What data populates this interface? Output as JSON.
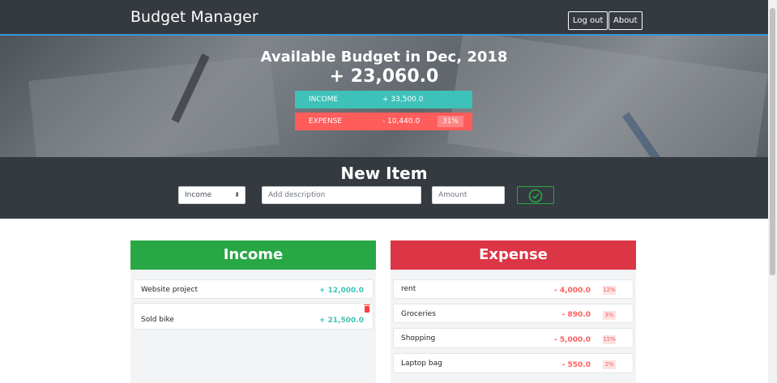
{
  "app": {
    "title": "Budget Manager"
  },
  "nav": {
    "logout": "Log out",
    "about": "About"
  },
  "budget": {
    "title": "Available Budget in Dec, 2018",
    "value": "+ 23,060.0",
    "income_label": "INCOME",
    "income_value": "+ 33,500.0",
    "expense_label": "EXPENSE",
    "expense_value": "- 10,440.0",
    "expense_percent": "31%"
  },
  "new_item": {
    "title": "New Item",
    "type_selected": "Income",
    "description_placeholder": "Add description",
    "amount_placeholder": "Amount"
  },
  "income": {
    "title": "Income",
    "items": [
      {
        "description": "Website project",
        "amount": "+ 12,000.0"
      },
      {
        "description": "Sold bike",
        "amount": "+ 21,500.0"
      }
    ]
  },
  "expense": {
    "title": "Expense",
    "items": [
      {
        "description": "rent",
        "amount": "- 4,000.0",
        "percent": "12%"
      },
      {
        "description": "Groceries",
        "amount": "- 890.0",
        "percent": "3%"
      },
      {
        "description": "Shopping",
        "amount": "- 5,000.0",
        "percent": "15%"
      },
      {
        "description": "Laptop bag",
        "amount": "- 550.0",
        "percent": "2%"
      }
    ]
  },
  "colors": {
    "income": "#3ec1b8",
    "expense": "#ff5c5c",
    "navbar": "#343a40",
    "income_header": "#28a745",
    "expense_header": "#dc3545"
  }
}
